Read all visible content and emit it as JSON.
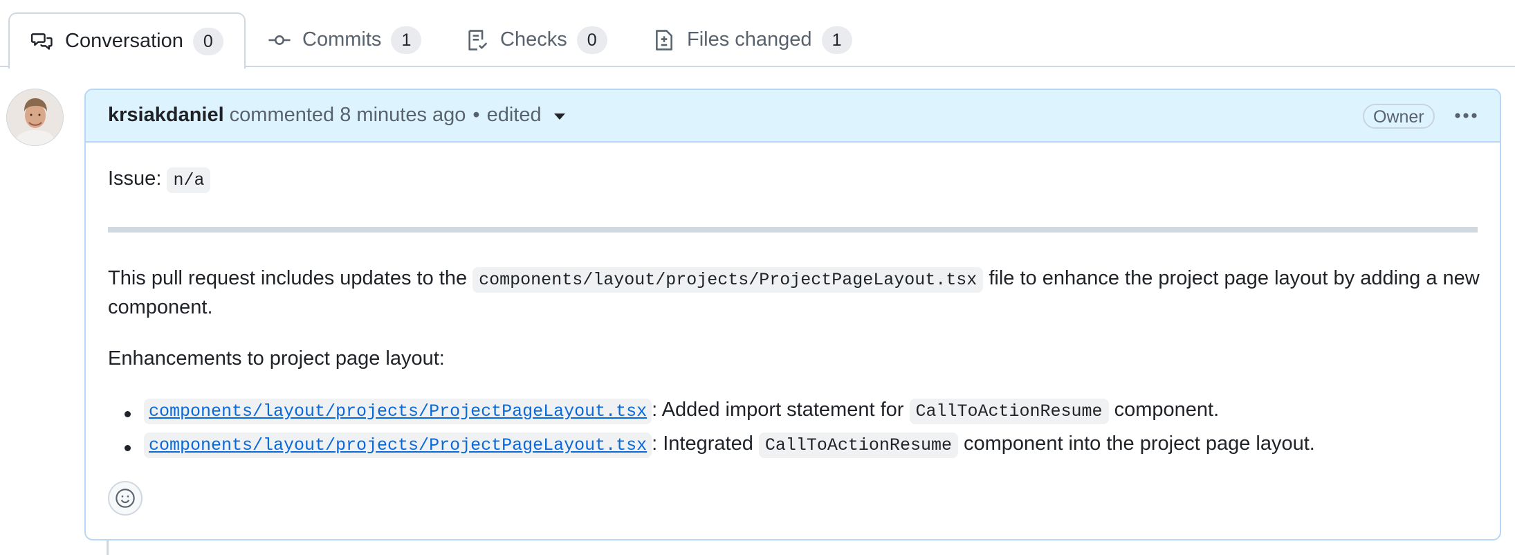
{
  "tabs": [
    {
      "label": "Conversation",
      "count": "0",
      "icon": "comment-discussion-icon",
      "selected": true
    },
    {
      "label": "Commits",
      "count": "1",
      "icon": "git-commit-icon"
    },
    {
      "label": "Checks",
      "count": "0",
      "icon": "checklist-icon"
    },
    {
      "label": "Files changed",
      "count": "1",
      "icon": "file-diff-icon"
    }
  ],
  "comment": {
    "author": "krsiakdaniel",
    "action": "commented",
    "time": "8 minutes ago",
    "separator": "•",
    "edited": "edited",
    "role": "Owner",
    "issue_label": "Issue:",
    "issue_value": "n/a",
    "intro_before": "This pull request includes updates to the",
    "intro_code": "components/layout/projects/ProjectPageLayout.tsx",
    "intro_after": "file to enhance the project page layout by adding a new",
    "intro_line2": "component.",
    "section_heading": "Enhancements to project page layout:",
    "bullets": [
      {
        "link": "components/layout/projects/ProjectPageLayout.tsx",
        "text_before": ": Added import statement for",
        "code": "CallToActionResume",
        "text_after": "component."
      },
      {
        "link": "components/layout/projects/ProjectPageLayout.tsx",
        "text_before": ": Integrated",
        "code": "CallToActionResume",
        "text_after": "component into the project page layout."
      }
    ]
  },
  "colors": {
    "accent": "#0969da",
    "header_bg": "#ddf4ff",
    "border": "#b6d7f5"
  }
}
